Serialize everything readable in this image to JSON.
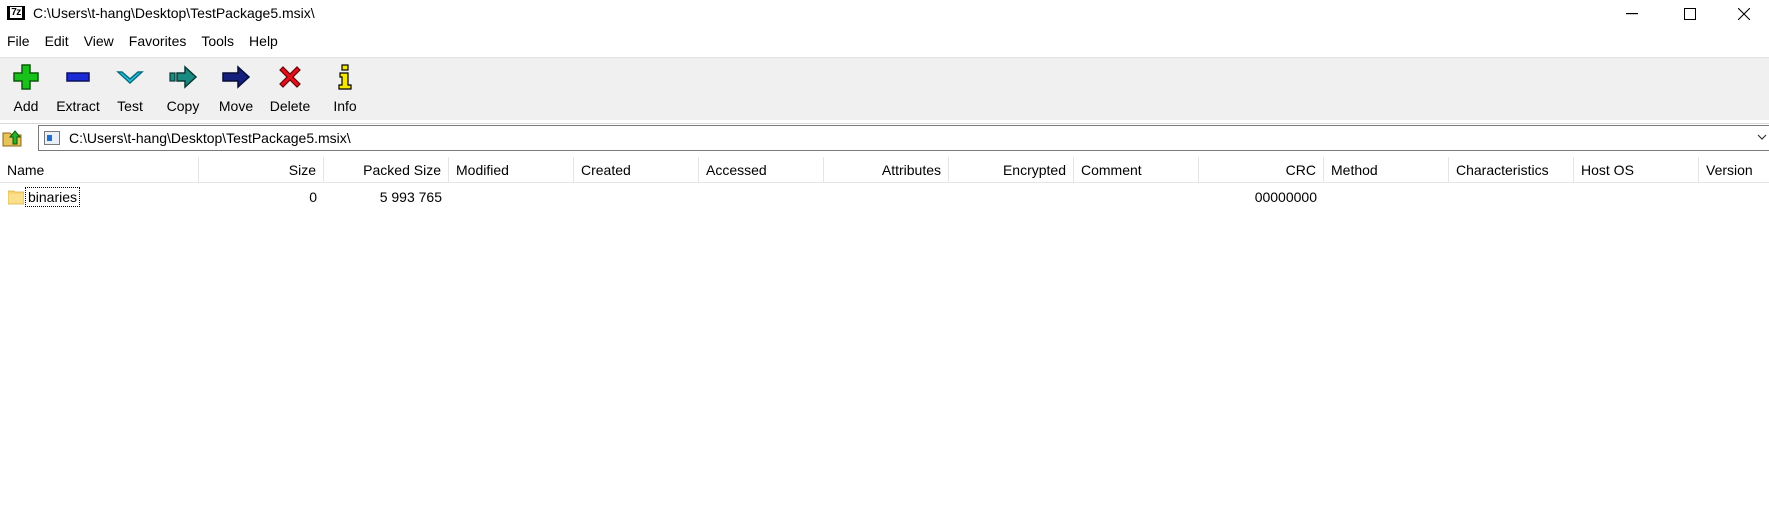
{
  "window": {
    "title": "C:\\Users\\t-hang\\Desktop\\TestPackage5.msix\\",
    "app_icon_text": "7z",
    "controls": [
      "minimize-icon",
      "maximize-icon",
      "close-icon"
    ]
  },
  "menu": {
    "file": "File",
    "edit": "Edit",
    "view": "View",
    "favorites": "Favorites",
    "tools": "Tools",
    "help": "Help"
  },
  "toolbar": {
    "add": "Add",
    "extract": "Extract",
    "test": "Test",
    "copy": "Copy",
    "move": "Move",
    "delete": "Delete",
    "info": "Info"
  },
  "address": {
    "path": "C:\\Users\\t-hang\\Desktop\\TestPackage5.msix\\"
  },
  "columns": {
    "name": "Name",
    "size": "Size",
    "packed_size": "Packed Size",
    "modified": "Modified",
    "created": "Created",
    "accessed": "Accessed",
    "attributes": "Attributes",
    "encrypted": "Encrypted",
    "comment": "Comment",
    "crc": "CRC",
    "method": "Method",
    "characteristics": "Characteristics",
    "host_os": "Host OS",
    "version": "Version"
  },
  "rows": [
    {
      "icon": "folder-icon",
      "name": "binaries",
      "size": "0",
      "packed_size": "5 993 765",
      "crc": "00000000"
    }
  ],
  "colors": {
    "toolbar_bg": "#f0f0f0",
    "add_green": "#19c21b",
    "extract_blue": "#1a2bd6",
    "test_cyan": "#26c6e0",
    "copy_teal": "#1b8a83",
    "move_navy": "#15207d",
    "delete_red": "#e0111a",
    "info_yellow": "#f5e800"
  }
}
